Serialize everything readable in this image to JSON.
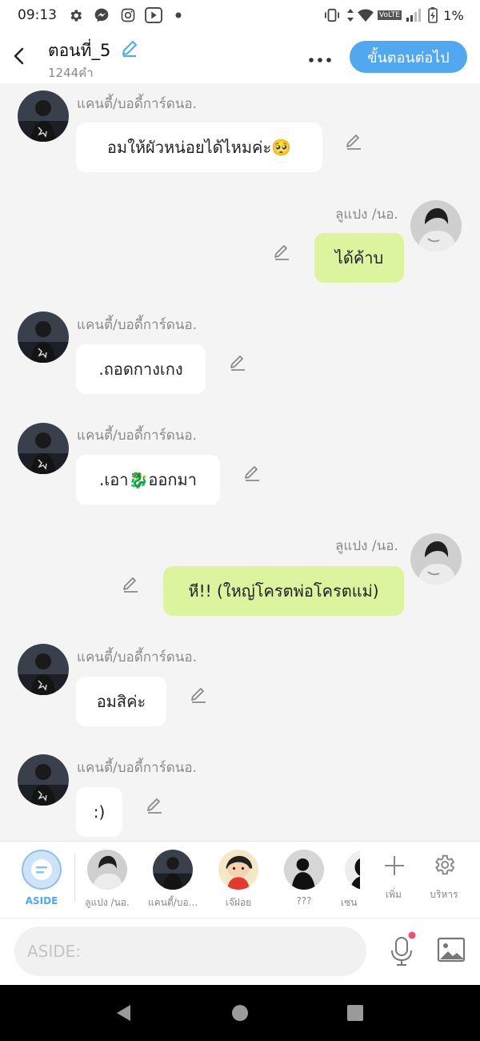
{
  "status_bar": {
    "time": "09:13",
    "network": "VoLTE",
    "battery": "1%"
  },
  "header": {
    "title": "ตอนที่_5",
    "subtitle": "1244คำ",
    "next_button": "ขั้นตอนต่อไป"
  },
  "messages": [
    {
      "side": "left",
      "sender": "แคนตี้/บอดี้การ์ดนอ.",
      "text": "อมให้ผัวหน่อยได้ไหมค่ะ🥺"
    },
    {
      "side": "right",
      "sender": "ลูแปง /นอ.",
      "text": "ได้ค้าบ"
    },
    {
      "side": "left",
      "sender": "แคนตี้/บอดี้การ์ดนอ.",
      "text": ".ถอดกางเกง"
    },
    {
      "side": "left",
      "sender": "แคนตี้/บอดี้การ์ดนอ.",
      "text": ".เอา🐉ออกมา"
    },
    {
      "side": "right",
      "sender": "ลูแปง /นอ.",
      "text": "หี!! (ใหญ่โครตพ่อโครตแม่)"
    },
    {
      "side": "left",
      "sender": "แคนตี้/บอดี้การ์ดนอ.",
      "text": "อมสิค่ะ"
    },
    {
      "side": "left",
      "sender": "แคนตี้/บอดี้การ์ดนอ.",
      "text": ":)"
    }
  ],
  "cast_bar": {
    "aside_label": "ASIDE",
    "characters": [
      "ลูแปง /นอ.",
      "แคนตี้/บอ...",
      "เจ๊ฝอย",
      "???",
      "เซน"
    ],
    "add_label": "เพิ่ม",
    "manage_label": "บริหาร"
  },
  "input_bar": {
    "placeholder": "ASIDE:"
  },
  "colors": {
    "accent": "#52a8ee",
    "right_bubble": "#dcf49d",
    "left_bubble": "#ffffff",
    "background": "#f4f4f4"
  }
}
